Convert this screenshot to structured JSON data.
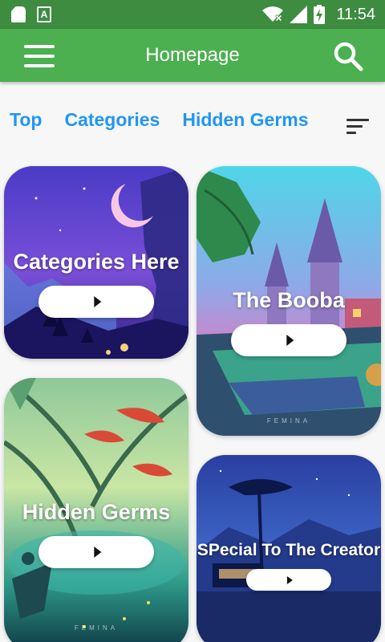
{
  "status_bar": {
    "time": "11:54",
    "icons": [
      "sd-card-icon",
      "font-download-icon",
      "wifi-off-icon",
      "signal-icon",
      "battery-charging-icon"
    ]
  },
  "app_bar": {
    "title": "Homepage",
    "menu_icon": "hamburger-menu-icon",
    "search_icon": "search-icon",
    "color": "#4caf50",
    "status_color": "#3d8c40"
  },
  "tabs": [
    {
      "label": "Top"
    },
    {
      "label": "Categories"
    },
    {
      "label": "Hidden Germs"
    }
  ],
  "sort_icon": "sort-icon",
  "accent_color": "#2196f3",
  "cards": [
    {
      "title": "Categories Here",
      "button_icon": "play-icon"
    },
    {
      "title": "The Booba",
      "button_icon": "play-icon",
      "watermark": "FEMINA"
    },
    {
      "title": "Hidden Germs",
      "button_icon": "play-icon",
      "watermark": "FEMINA"
    },
    {
      "title": "SPecial To The Creator",
      "button_icon": "play-icon"
    }
  ]
}
